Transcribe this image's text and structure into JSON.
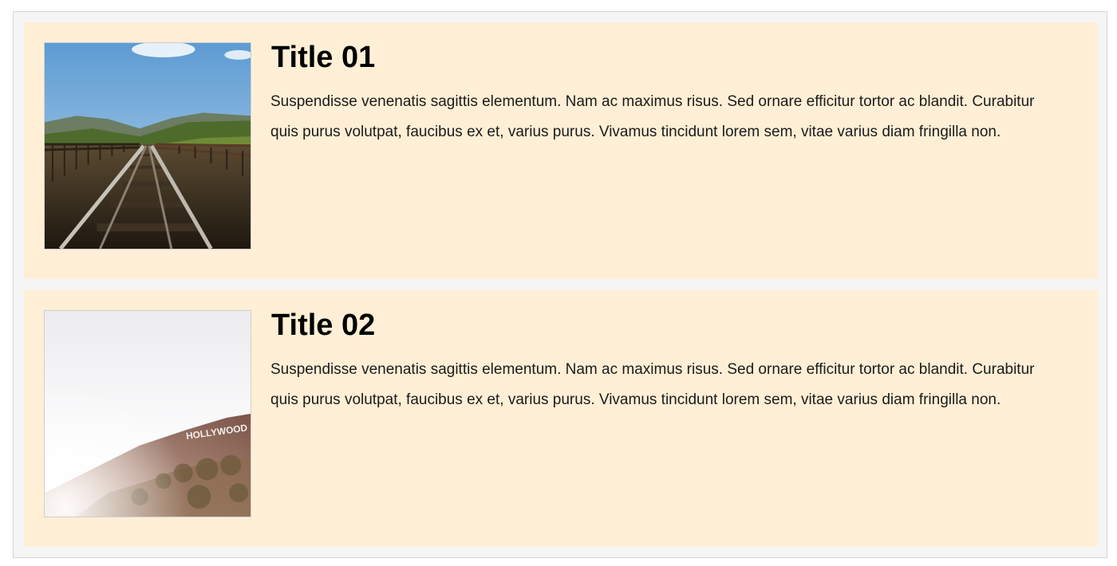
{
  "cards": [
    {
      "title": "Title 01",
      "text": "Suspendisse venenatis sagittis elementum. Nam ac maximus risus. Sed ornare efficitur tortor ac blandit. Curabitur quis purus volutpat, faucibus ex et, varius purus. Vivamus tincidunt lorem sem, vitae varius diam fringilla non.",
      "image_subject": "railway-bridge-photo"
    },
    {
      "title": "Title 02",
      "text": "Suspendisse venenatis sagittis elementum. Nam ac maximus risus. Sed ornare efficitur tortor ac blandit. Curabitur quis purus volutpat, faucibus ex et, varius purus. Vivamus tincidunt lorem sem, vitae varius diam fringilla non.",
      "image_subject": "hollywood-sign-hill-photo",
      "image_text": "HOLLYWOOD"
    }
  ],
  "colors": {
    "card_background": "#ffefd6",
    "container_background": "#f5f5f5"
  }
}
